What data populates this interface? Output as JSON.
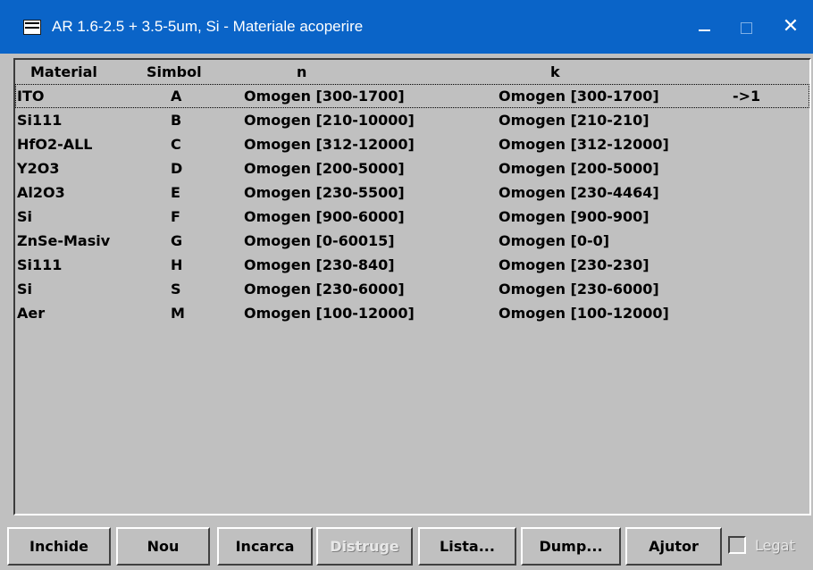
{
  "window": {
    "title": "AR 1.6-2.5 + 3.5-5um, Si - Materiale acoperire",
    "minimize_glyph": "—",
    "maximize_glyph": "☐",
    "close_glyph": "✕",
    "icon": "window-app-icon",
    "title_bar_color": "#0a64c8"
  },
  "table": {
    "headers": {
      "material": "Material",
      "simbol": "Simbol",
      "n": "n",
      "k": "k"
    },
    "rows": [
      {
        "material": "ITO",
        "simbol": "A",
        "n": "Omogen [300-1700]",
        "k": "Omogen [300-1700]",
        "extra": "->1",
        "selected": true
      },
      {
        "material": "Si111",
        "simbol": "B",
        "n": "Omogen [210-10000]",
        "k": "Omogen [210-210]",
        "extra": ""
      },
      {
        "material": "HfO2-ALL",
        "simbol": "C",
        "n": "Omogen [312-12000]",
        "k": "Omogen [312-12000]",
        "extra": ""
      },
      {
        "material": "Y2O3",
        "simbol": "D",
        "n": "Omogen [200-5000]",
        "k": "Omogen [200-5000]",
        "extra": ""
      },
      {
        "material": "Al2O3",
        "simbol": "E",
        "n": "Omogen [230-5500]",
        "k": "Omogen [230-4464]",
        "extra": ""
      },
      {
        "material": "Si",
        "simbol": "F",
        "n": "Omogen [900-6000]",
        "k": "Omogen [900-900]",
        "extra": ""
      },
      {
        "material": "ZnSe-Masiv",
        "simbol": "G",
        "n": "Omogen [0-60015]",
        "k": "Omogen [0-0]",
        "extra": ""
      },
      {
        "material": "Si111",
        "simbol": "H",
        "n": "Omogen [230-840]",
        "k": "Omogen [230-230]",
        "extra": ""
      },
      {
        "material": "Si",
        "simbol": "S",
        "n": "Omogen [230-6000]",
        "k": "Omogen [230-6000]",
        "extra": ""
      },
      {
        "material": "Aer",
        "simbol": "M",
        "n": "Omogen [100-12000]",
        "k": "Omogen [100-12000]",
        "extra": ""
      }
    ]
  },
  "buttons": {
    "inchide": "Inchide",
    "nou": "Nou",
    "incarca": "Incarca",
    "distruge": "Distruge",
    "lista": "Lista...",
    "dump": "Dump...",
    "ajutor": "Ajutor"
  },
  "checkbox": {
    "label": "Legat",
    "checked": false
  }
}
